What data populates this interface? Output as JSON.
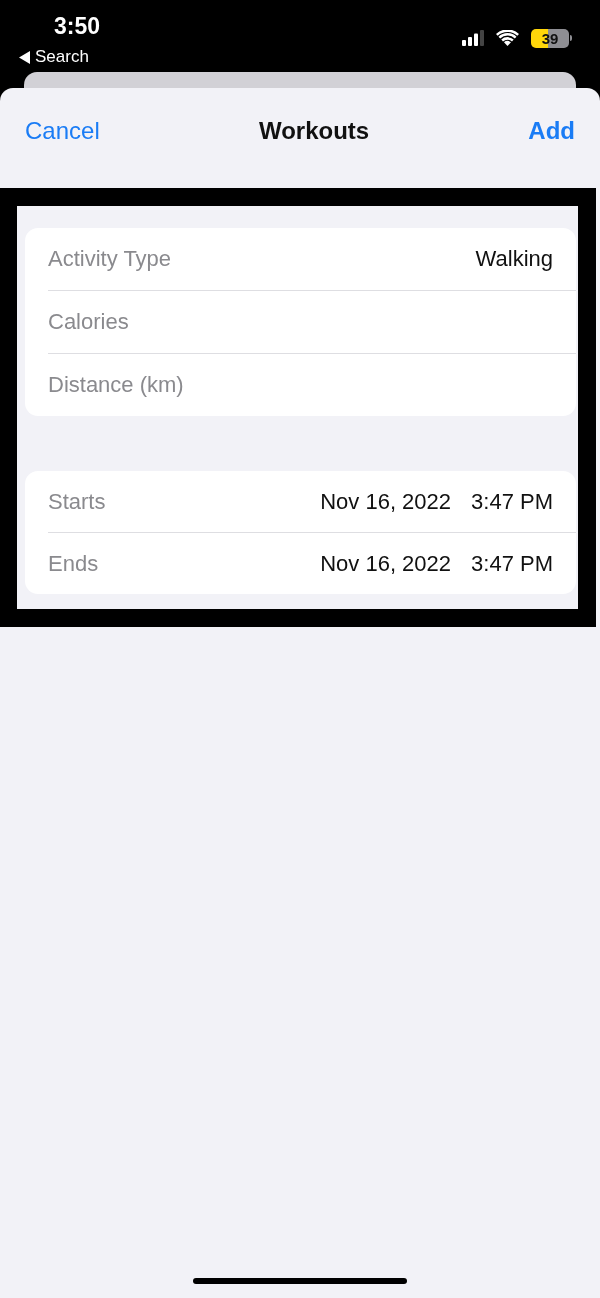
{
  "status_bar": {
    "time": "3:50",
    "back_label": "Search",
    "battery": "39"
  },
  "nav_bar": {
    "cancel": "Cancel",
    "title": "Workouts",
    "add": "Add"
  },
  "sections": [
    {
      "rows": [
        {
          "kind": "picker",
          "label": "Activity Type",
          "value": "Walking"
        },
        {
          "kind": "input",
          "placeholder": "Calories"
        },
        {
          "kind": "input",
          "placeholder": "Distance (km)"
        }
      ]
    },
    {
      "rows": [
        {
          "kind": "datetime",
          "label": "Starts",
          "date": "Nov 16, 2022",
          "time": "3:47 PM"
        },
        {
          "kind": "datetime",
          "label": "Ends",
          "date": "Nov 16, 2022",
          "time": "3:47 PM"
        }
      ]
    }
  ]
}
